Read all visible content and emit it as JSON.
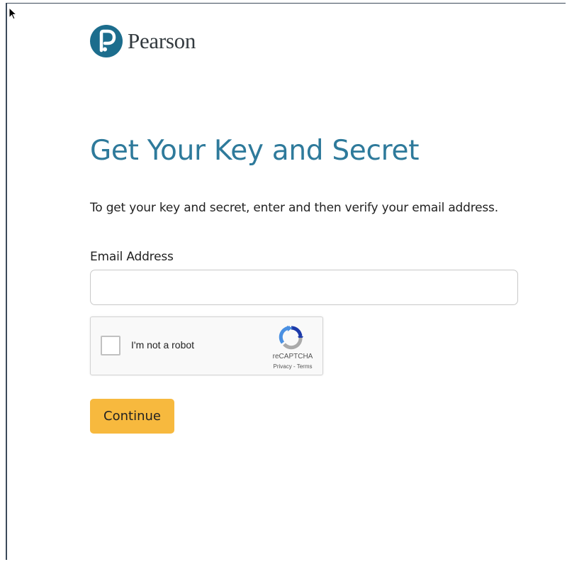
{
  "brand": {
    "name": "Pearson",
    "logo_glyph": "P",
    "mark_color": "#1c6d8d"
  },
  "page": {
    "title": "Get Your Key and Secret",
    "description": "To get your key and secret, enter and then verify your email address."
  },
  "form": {
    "email_label": "Email Address",
    "email_value": "",
    "email_placeholder": "",
    "continue_label": "Continue",
    "continue_color": "#f7b93e"
  },
  "captcha": {
    "label": "I'm not a robot",
    "checked": false,
    "brand": "reCAPTCHA",
    "privacy_label": "Privacy",
    "separator": " - ",
    "terms_label": "Terms",
    "icon": "recaptcha-icon"
  },
  "colors": {
    "title": "#2e7a9b",
    "border": "#3c4a5a"
  }
}
